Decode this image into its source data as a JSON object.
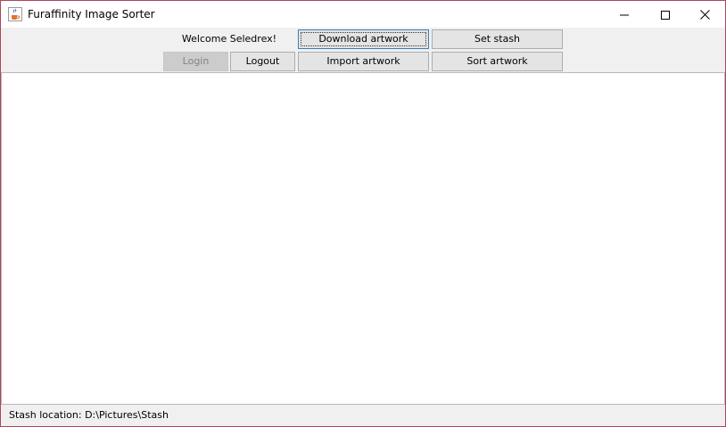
{
  "window": {
    "title": "Furaffinity Image Sorter",
    "app_icon": "java-cup-icon",
    "controls": [
      "minimize-icon",
      "maximize-icon",
      "close-icon"
    ]
  },
  "toolbar": {
    "welcome_text": "Welcome Seledrex!",
    "download_label": "Download artwork",
    "set_stash_label": "Set stash",
    "login_label": "Login",
    "logout_label": "Logout",
    "import_label": "Import artwork",
    "sort_label": "Sort artwork",
    "login_enabled": false
  },
  "statusbar": {
    "text": "Stash location: D:\\Pictures\\Stash"
  },
  "colors": {
    "window_border": "#b0445a",
    "focused_border": "#3c7fb1"
  }
}
